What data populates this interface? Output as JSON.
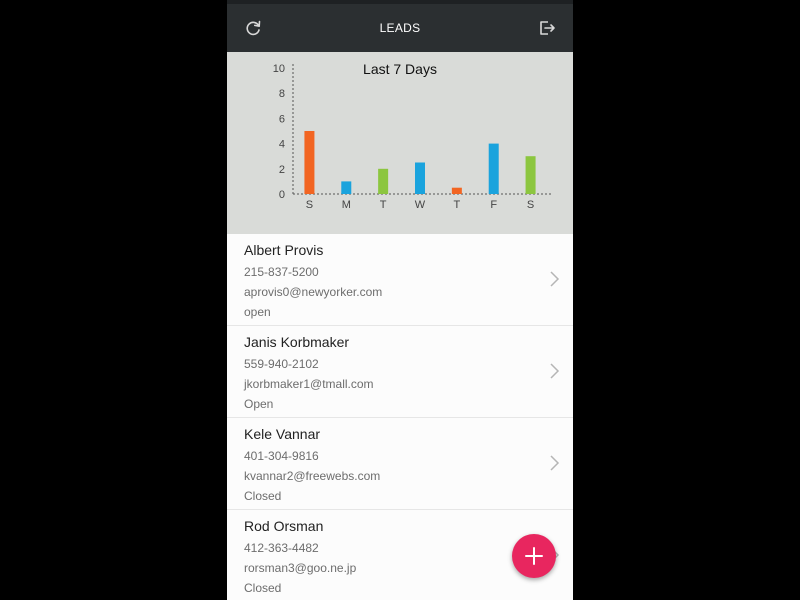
{
  "appbar": {
    "title": "LEADS",
    "left_icon": "refresh-icon",
    "right_icon": "logout-icon"
  },
  "chart_data": {
    "type": "bar",
    "title": "Last 7 Days",
    "categories": [
      "S",
      "M",
      "T",
      "W",
      "T",
      "F",
      "S"
    ],
    "values": [
      5,
      1,
      2,
      2.5,
      0.5,
      4,
      3
    ],
    "yticks": [
      0,
      2,
      4,
      6,
      8,
      10
    ],
    "ylim": [
      0,
      10
    ],
    "bar_colors": [
      "#f26522",
      "#1aa3dd",
      "#8cc63f",
      "#1aa3dd",
      "#f26522",
      "#1aa3dd",
      "#8cc63f"
    ],
    "grid": false
  },
  "leads": [
    {
      "name": "Albert Provis",
      "phone": "215-837-5200",
      "email": "aprovis0@newyorker.com",
      "status": "open"
    },
    {
      "name": "Janis Korbmaker",
      "phone": "559-940-2102",
      "email": "jkorbmaker1@tmall.com",
      "status": "Open"
    },
    {
      "name": "Kele Vannar",
      "phone": "401-304-9816",
      "email": "kvannar2@freewebs.com",
      "status": "Closed"
    },
    {
      "name": "Rod Orsman",
      "phone": "412-363-4482",
      "email": "rorsman3@goo.ne.jp",
      "status": "Closed"
    }
  ],
  "fab": {
    "icon": "plus-icon",
    "color": "#e8265f"
  },
  "colors": {
    "appbar": "#2b2f31",
    "chart_bg": "#d9dbd8"
  }
}
